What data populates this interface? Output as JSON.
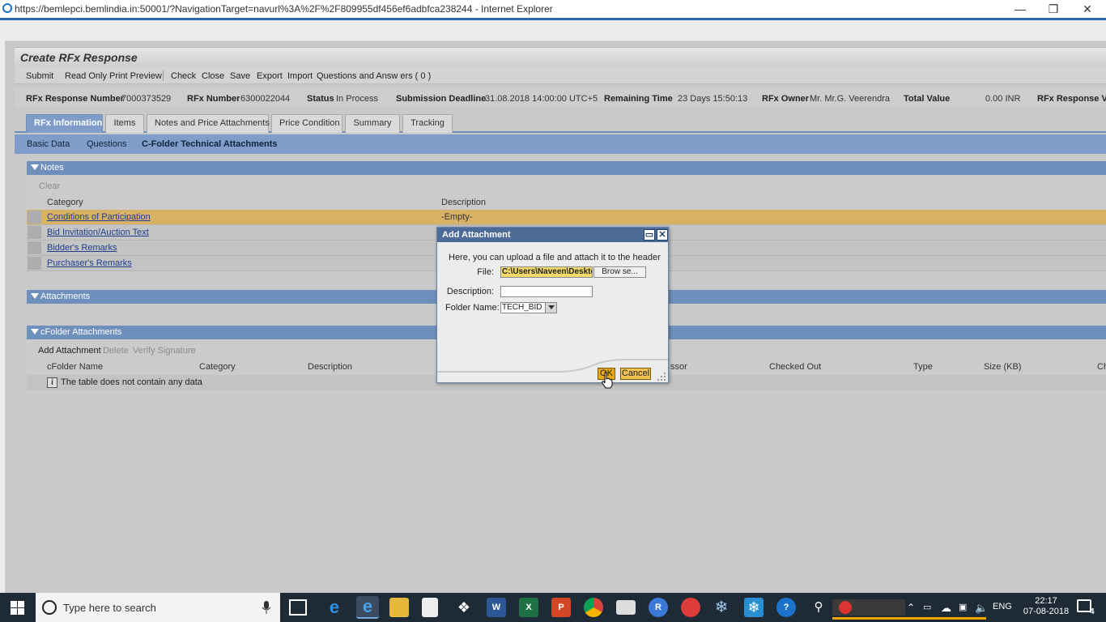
{
  "window": {
    "title": "https://bemlepci.bemlindia.in:50001/?NavigationTarget=navurl%3A%2F%2F809955df456ef6adbfca238244 - Internet Explorer",
    "minimize": "—",
    "restore": "❐",
    "close": "✕"
  },
  "app": {
    "title": "Create RFx Response",
    "toolbar": [
      "Submit",
      "Read Only",
      "Print Preview",
      "Check",
      "Close",
      "Save",
      "Export",
      "Import",
      "Questions and Answ ers ( 0 )"
    ]
  },
  "header_fields": {
    "rfx_response_number_label": "RFx Response Number",
    "rfx_response_number": "7000373529",
    "rfx_number_label": "RFx Number",
    "rfx_number": "6300022044",
    "status_label": "Status",
    "status": "In Process",
    "submission_deadline_label": "Submission Deadline",
    "submission_deadline": "31.08.2018 14:00:00 UTC+5",
    "remaining_time_label": "Remaining Time",
    "remaining_time": "23 Days 15:50:13",
    "rfx_owner_label": "RFx Owner",
    "rfx_owner": "Mr. Mr.G. Veerendra",
    "total_value_label": "Total Value",
    "total_value": "0.00 INR",
    "rfx_response_version_label": "RFx Response Ve"
  },
  "tabs": [
    "RFx Information",
    "Items",
    "Notes and Price Attachments",
    "Price Condition",
    "Summary",
    "Tracking"
  ],
  "subtabs": [
    "Basic Data",
    "Questions",
    "C-Folder Technical Attachments"
  ],
  "notes": {
    "header": "Notes",
    "clear": "Clear",
    "col_category": "Category",
    "col_description": "Description",
    "rows": [
      {
        "category": "Conditions of Participation",
        "description": "-Empty-"
      },
      {
        "category": "Bid Invitation/Auction Text",
        "description": ""
      },
      {
        "category": "Bidder's Remarks",
        "description": ""
      },
      {
        "category": "Purchaser's Remarks",
        "description": ""
      }
    ]
  },
  "attachments": {
    "header": "Attachments"
  },
  "cfolder": {
    "header": "cFolder Attachments",
    "actions": [
      "Add Attachment",
      "Delete",
      "Verify Signature"
    ],
    "columns": [
      "cFolder Name",
      "Category",
      "Description",
      "ssor",
      "Checked Out",
      "Type",
      "Size (KB)",
      "Ch"
    ],
    "empty_text": "The table does not contain any data"
  },
  "dialog": {
    "title": "Add Attachment",
    "intro": "Here, you can upload a file and attach it to the header",
    "file_label": "File:",
    "file_value": "C:\\Users\\Naveen\\Desktop",
    "browse": "Brow se...",
    "description_label": "Description:",
    "description_value": "",
    "folder_label": "Folder Name:",
    "folder_value": "TECH_BID",
    "ok": "OK",
    "cancel": "Cancel"
  },
  "taskbar": {
    "search_placeholder": "Type here to search",
    "language": "ENG",
    "time": "22:17",
    "date": "07-08-2018",
    "notifications": "4"
  },
  "colors": {
    "accent": "#7f9dc8",
    "section_header": "#6f8fbc",
    "selected_row": "#d8b264",
    "dialog_title": "#4d6b96",
    "ok_button": "#e8a81c"
  }
}
